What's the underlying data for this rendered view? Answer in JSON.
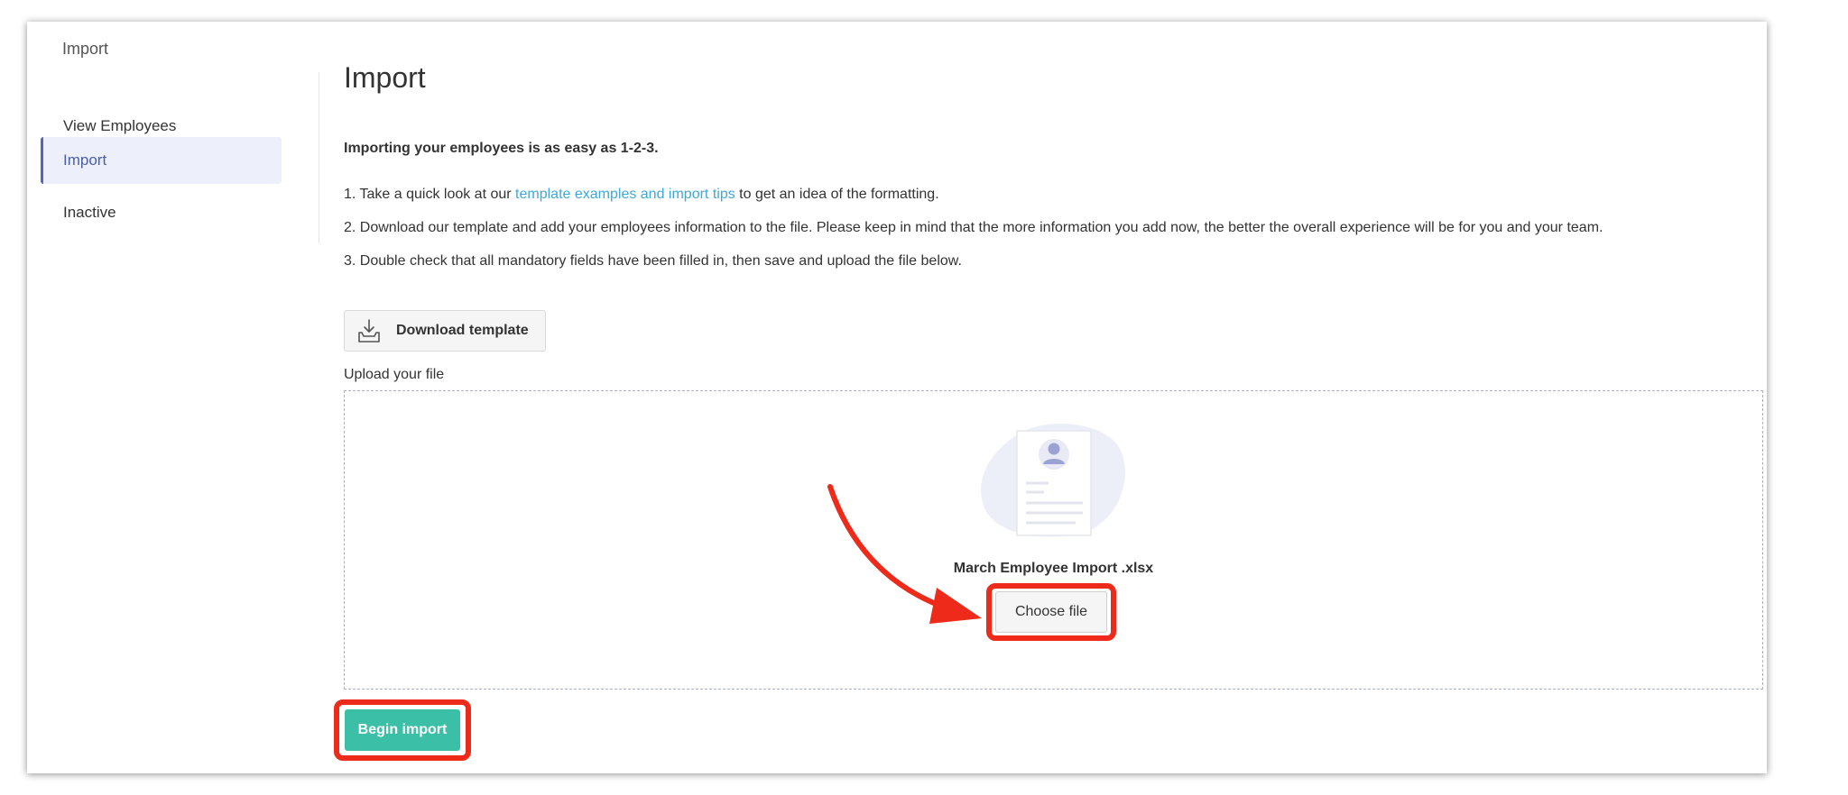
{
  "sidebar": {
    "section_title": "Import",
    "items": [
      {
        "label": "View Employees",
        "active": false
      },
      {
        "label": "Import",
        "active": true
      },
      {
        "label": "Inactive",
        "active": false
      }
    ]
  },
  "main": {
    "title": "Import",
    "intro": "Importing your employees is as easy as 1-2-3.",
    "steps": [
      {
        "before": "1. Take a quick look at our ",
        "link": "template examples and import tips",
        "after": " to get an idea of the formatting."
      },
      {
        "text": "2. Download our template and add your employees information to the file. Please keep in mind that the more information you add now, the better the overall experience will be for you and your team."
      },
      {
        "text": "3. Double check that all mandatory fields have been filled in, then save and upload the file below."
      }
    ],
    "download_button": "Download template",
    "upload_label": "Upload your file",
    "file_name": "March Employee Import .xlsx",
    "choose_button": "Choose file",
    "begin_button": "Begin import"
  },
  "icons": {
    "download": "download-tray-icon",
    "document": "employee-document-icon",
    "arrow": "red-arrow-annotation-icon"
  },
  "colors": {
    "accent_nav": "#5367b6",
    "link": "#3fa8d6",
    "primary_button": "#3bbfa7",
    "annotation": "#ee2a1a"
  }
}
